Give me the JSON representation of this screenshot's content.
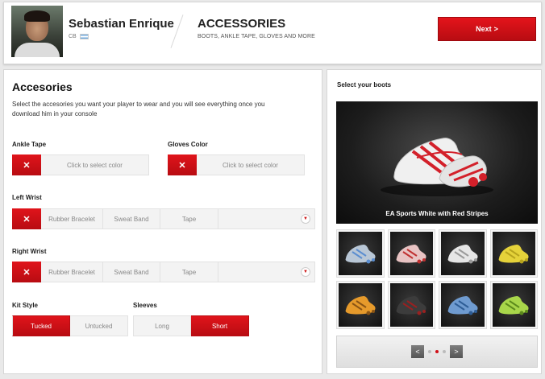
{
  "header": {
    "player_name": "Sebastian Enrique",
    "position": "CB",
    "section_title": "ACCESSORIES",
    "section_subtitle": "BOOTS, ANKLE TAPE, GLOVES AND MORE",
    "next_label": "Next",
    "next_chevron": ">"
  },
  "accessories": {
    "title": "Accesories",
    "description": "Select the accesories you want your player to wear and you will see everything once you download him in your console",
    "ankle_tape": {
      "label": "Ankle Tape",
      "x": "✕",
      "placeholder": "Click to select color"
    },
    "gloves_color": {
      "label": "Gloves Color",
      "x": "✕",
      "placeholder": "Click to select color"
    },
    "left_wrist": {
      "label": "Left Wrist",
      "x": "✕",
      "options": [
        "Rubber Bracelet",
        "Sweat Band",
        "Tape"
      ],
      "dropdown_arrow": "▼"
    },
    "right_wrist": {
      "label": "Right Wrist",
      "x": "✕",
      "options": [
        "Rubber Bracelet",
        "Sweat Band",
        "Tape"
      ],
      "dropdown_arrow": "▼"
    },
    "kit_style": {
      "label": "Kit Style",
      "options": [
        "Tucked",
        "Untucked"
      ],
      "selected": "Tucked"
    },
    "sleeves": {
      "label": "Sleeves",
      "options": [
        "Long",
        "Short"
      ],
      "selected": "Short"
    }
  },
  "boots": {
    "title": "Select your boots",
    "featured_caption": "EA Sports White with Red Stripes",
    "featured_colors": [
      "#f2f2f2",
      "#d3202a"
    ],
    "thumbnails": [
      {
        "color": "#b9c7d6",
        "accent": "#5b8ed0"
      },
      {
        "color": "#e8c3c3",
        "accent": "#c03030"
      },
      {
        "color": "#e6e6e6",
        "accent": "#9a9a9a"
      },
      {
        "color": "#e5d23a",
        "accent": "#b8a41d"
      },
      {
        "color": "#e69a2b",
        "accent": "#8a5414"
      },
      {
        "color": "#3c3c3c",
        "accent": "#9a2020"
      },
      {
        "color": "#6f9bd0",
        "accent": "#2e5d96"
      },
      {
        "color": "#a8d64a",
        "accent": "#5c8a1c"
      }
    ],
    "pager": {
      "prev": "<",
      "next": ">",
      "pages": 3,
      "current": 2
    }
  },
  "colors": {
    "accent_red": "#d01018",
    "panel_bg": "#ffffff",
    "page_bg": "#e9e9e9"
  }
}
